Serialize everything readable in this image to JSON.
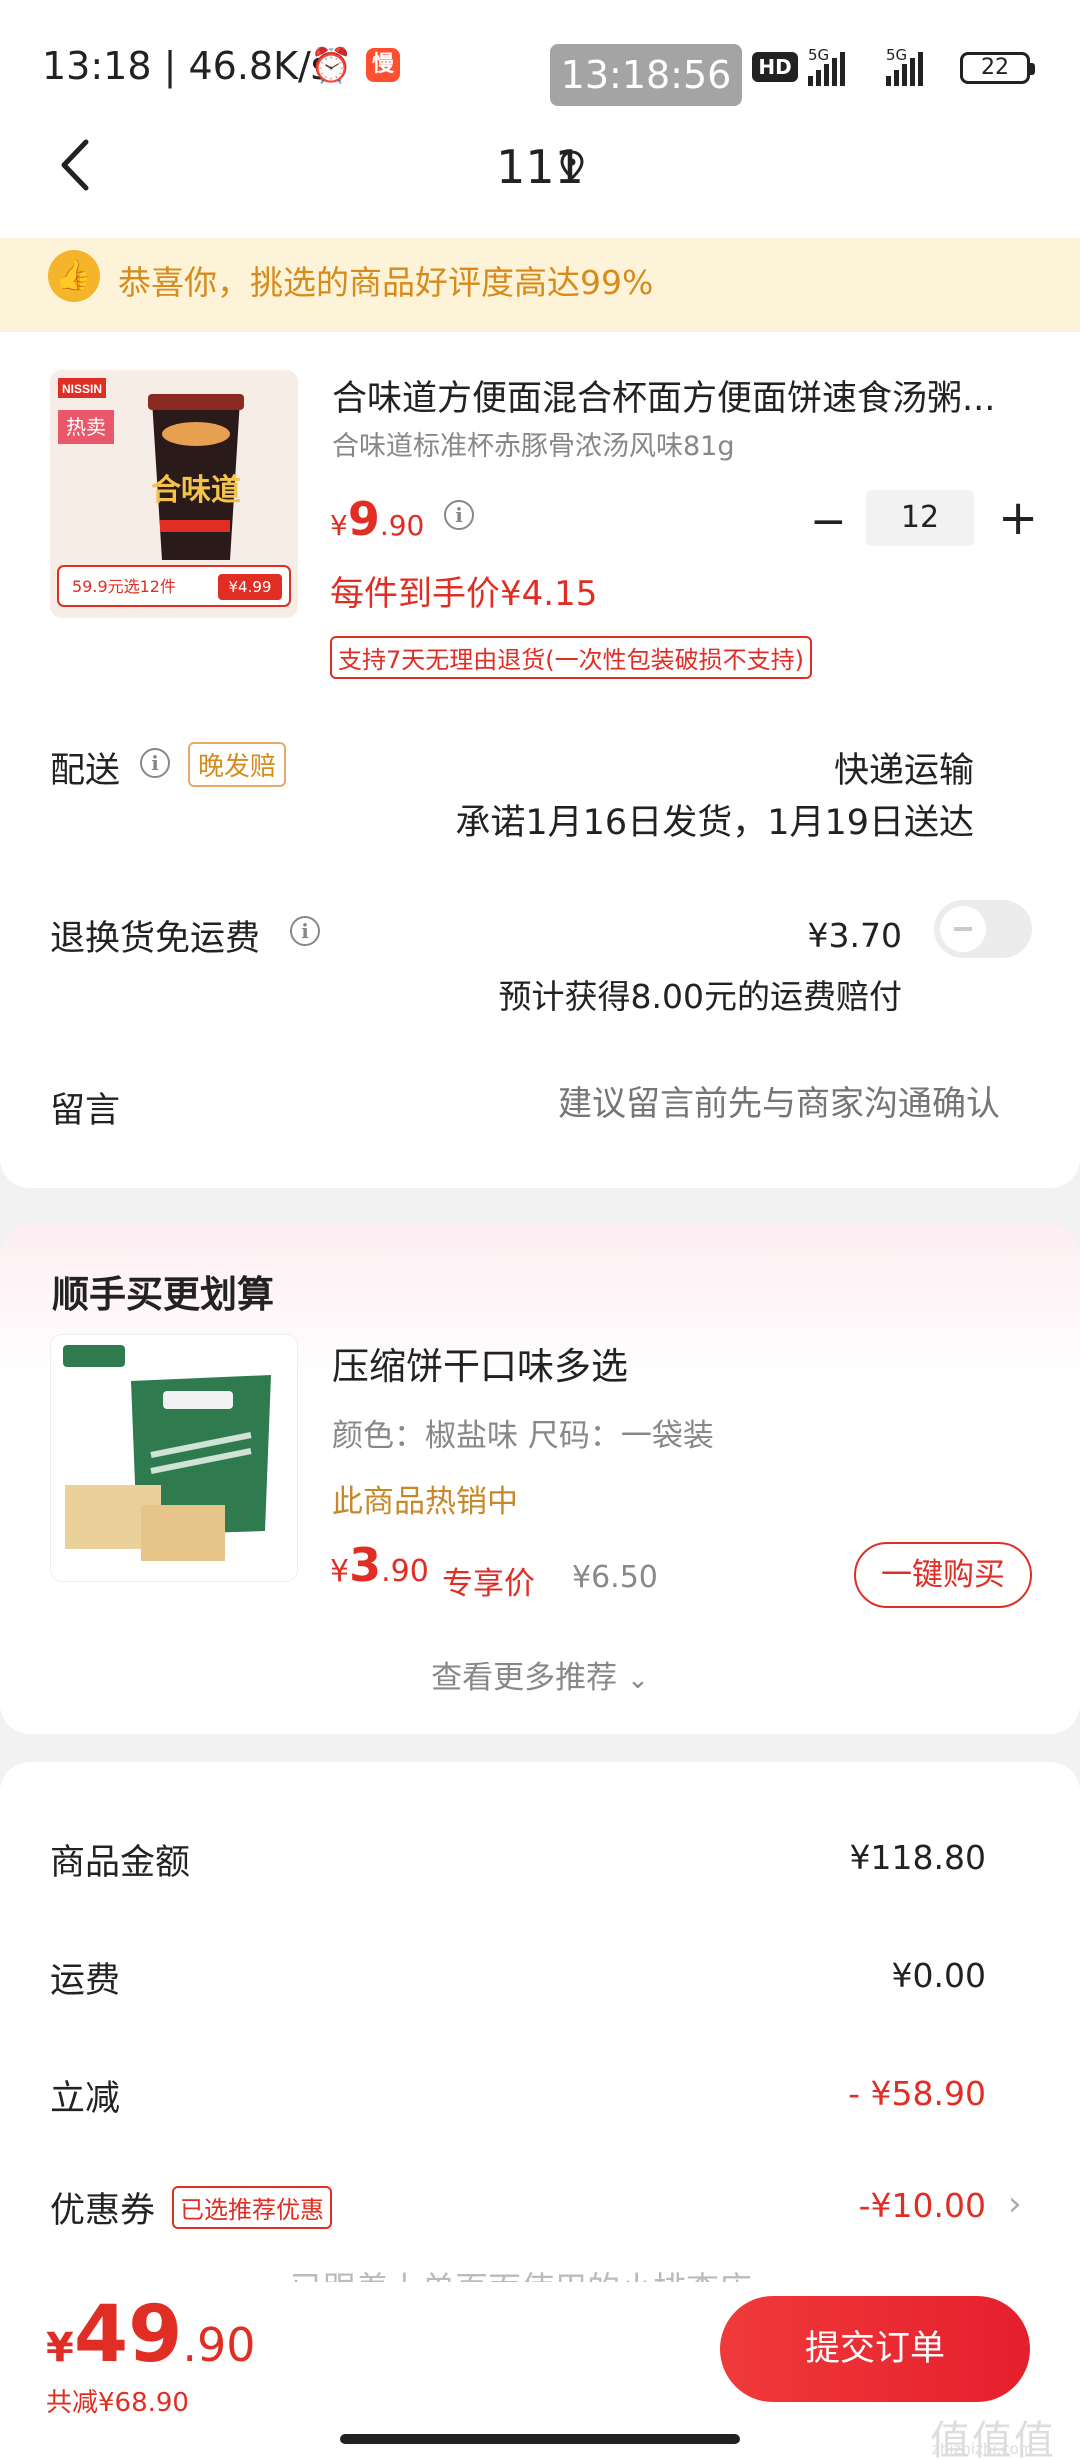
{
  "status_bar": {
    "time": "13:18 | 46.8K/s",
    "slow_badge": "慢",
    "clock": "13:18:56",
    "hd_label": "HD",
    "network_1": "5G",
    "network_2": "5G",
    "battery": "22"
  },
  "header": {
    "title": "111"
  },
  "banner": {
    "text": "恭喜你，挑选的商品好评度高达99%"
  },
  "product": {
    "name": "合味道方便面混合杯面方便面饼速食汤粥...",
    "spec": "合味道标准杯赤豚骨浓汤风味81g",
    "image_brand": "NISSIN",
    "image_hot": "热卖",
    "image_promo": "59.9元选12件",
    "image_price": "¥4.99",
    "price_symbol": "¥",
    "price_int": "9",
    "price_dec": ".90",
    "quantity": "12",
    "unit_price": "每件到手价¥4.15",
    "refund_tag": "支持7天无理由退货(一次性包装破损不支持)"
  },
  "delivery": {
    "label": "配送",
    "tag": "晚发赔",
    "method": "快递运输",
    "promise": "承诺1月16日发货，1月19日送达"
  },
  "return_shipping": {
    "label": "退换货免运费",
    "price": "¥3.70",
    "note": "预计获得8.00元的运费赔付",
    "enabled": false
  },
  "message": {
    "label": "留言",
    "placeholder": "建议留言前先与商家沟通确认"
  },
  "recommend": {
    "title": "顺手买更划算",
    "name": "压缩饼干口味多选",
    "spec": "颜色：椒盐味    尺码：一袋装",
    "hot": "此商品热销中",
    "price_symbol": "¥",
    "price_int": "3",
    "price_dec": ".90",
    "exclusive": "专享价",
    "original": "¥6.50",
    "buy_label": "一键购买",
    "more": "查看更多推荐"
  },
  "summary": {
    "goods_label": "商品金额",
    "goods_value": "¥118.80",
    "shipping_label": "运费",
    "shipping_value": "¥0.00",
    "discount_label": "立减",
    "discount_value": "- ¥58.90",
    "coupon_label": "优惠券",
    "coupon_tag": "已选推荐优惠",
    "coupon_value": "-¥10.00",
    "partial_line": "已跟着上单页面使用的小排查店"
  },
  "footer": {
    "total_symbol": "¥",
    "total_int": "49",
    "total_dec": ".90",
    "saved": "共减¥68.90",
    "submit_label": "提交订单"
  },
  "watermark": {
    "text": "值值值",
    "url": "zhizhizhi.com"
  },
  "colors": {
    "accent": "#e02e24",
    "banner_bg": "#fdf3d8",
    "banner_text": "#d88a1a"
  }
}
